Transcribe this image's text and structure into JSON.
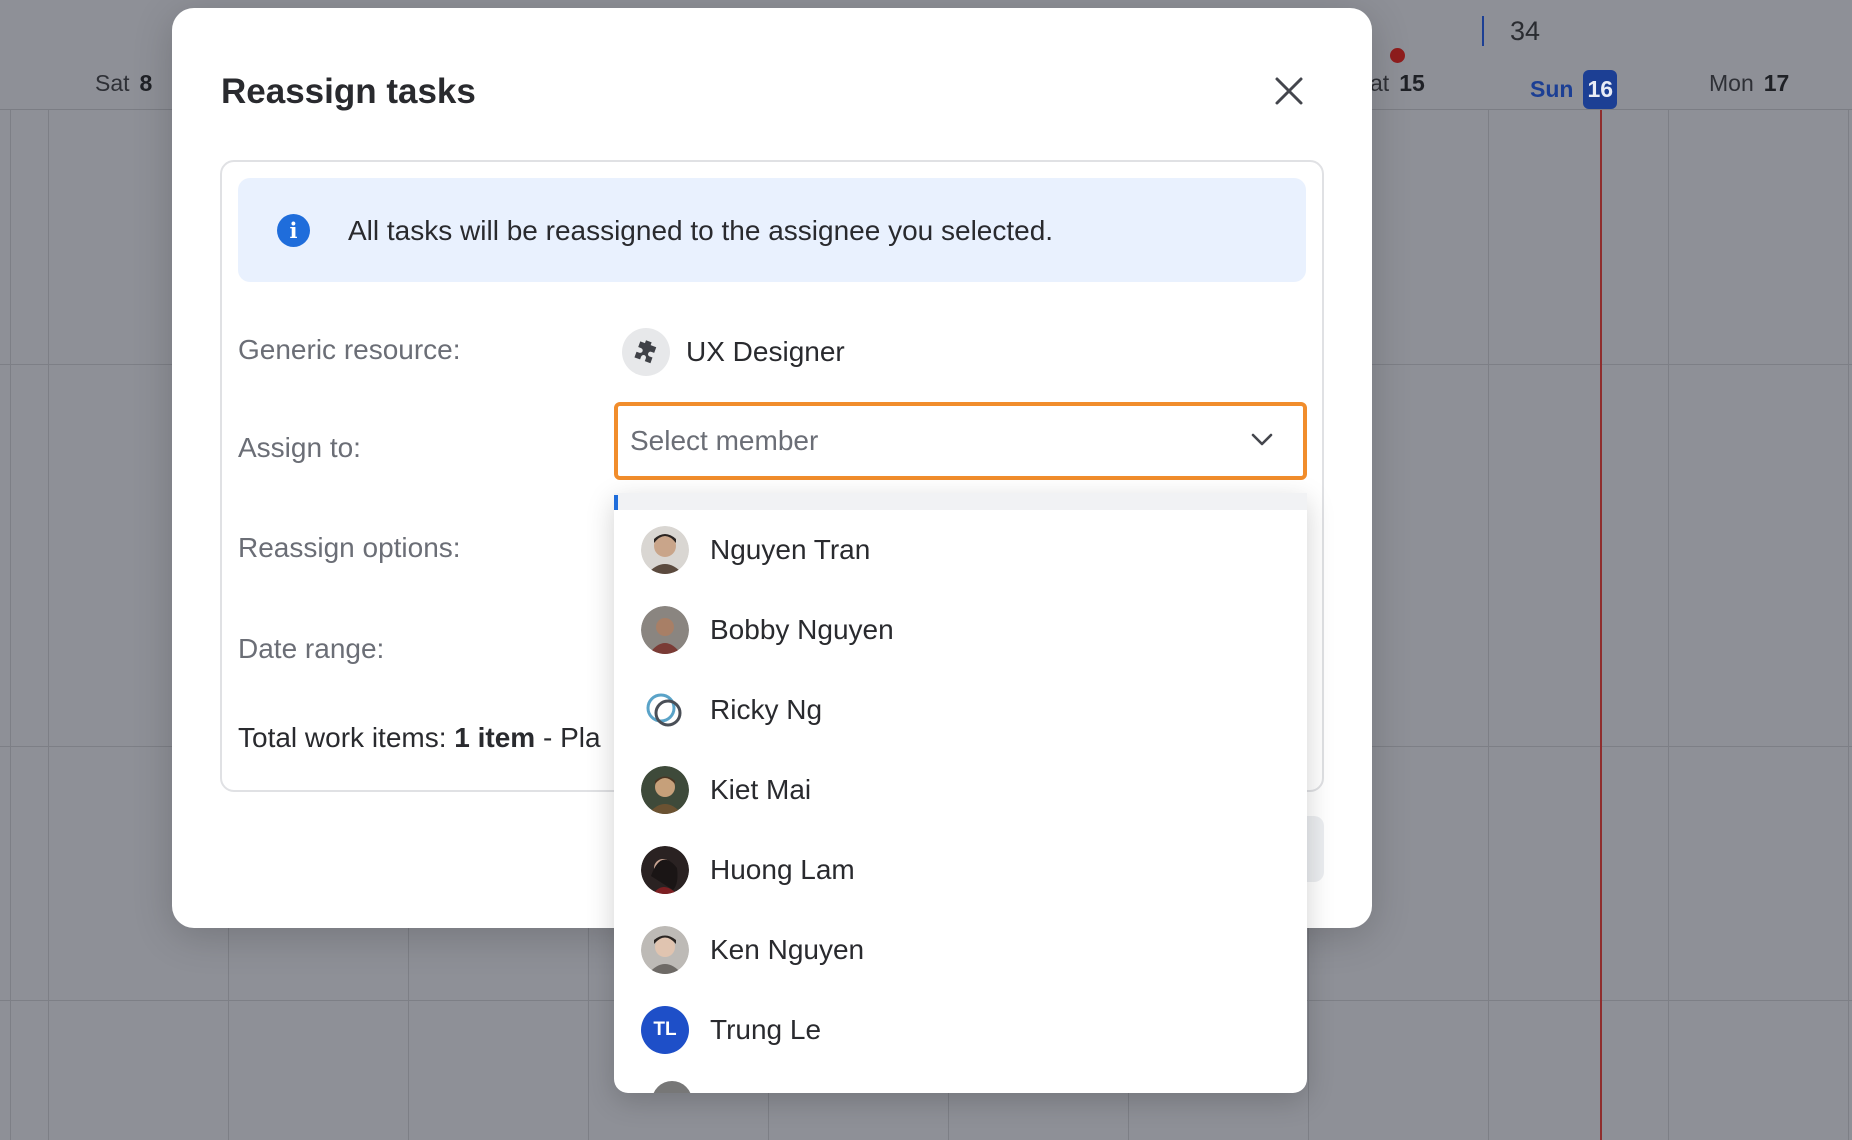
{
  "calendar": {
    "week_number": "34",
    "days": [
      {
        "name": "Sat",
        "num": "8"
      },
      {
        "name": "at",
        "num": "15"
      },
      {
        "name": "Sun",
        "num": "16"
      },
      {
        "name": "Mon",
        "num": "17"
      }
    ],
    "today_color": "#1c3f94"
  },
  "modal": {
    "title": "Reassign tasks",
    "info_text": "All tasks will be reassigned to the assignee you selected.",
    "labels": {
      "generic_resource": "Generic resource:",
      "assign_to": "Assign to:",
      "reassign_options": "Reassign options:",
      "date_range": "Date range:"
    },
    "generic_resource": {
      "name": "UX Designer",
      "icon": "puzzle-icon"
    },
    "assign_select": {
      "placeholder": "Select member",
      "focus_color": "#f18d2c"
    },
    "total": {
      "prefix": "Total work items: ",
      "count": "1 item",
      "suffix": " - Pla"
    }
  },
  "dropdown": {
    "members": [
      {
        "name": "Nguyen Tran",
        "avatar_color": "#5b4a3e"
      },
      {
        "name": "Bobby Nguyen",
        "avatar_color": "#7a3b35"
      },
      {
        "name": "Ricky Ng",
        "avatar_color": "#5aa3c8"
      },
      {
        "name": "Kiet Mai",
        "avatar_color": "#6b5232"
      },
      {
        "name": "Huong Lam",
        "avatar_color": "#2a2222"
      },
      {
        "name": "Ken Nguyen",
        "avatar_color": "#6e6a66"
      },
      {
        "name": "Trung Le",
        "initials": "TL",
        "avatar_color": "#1e4fc8"
      }
    ]
  }
}
